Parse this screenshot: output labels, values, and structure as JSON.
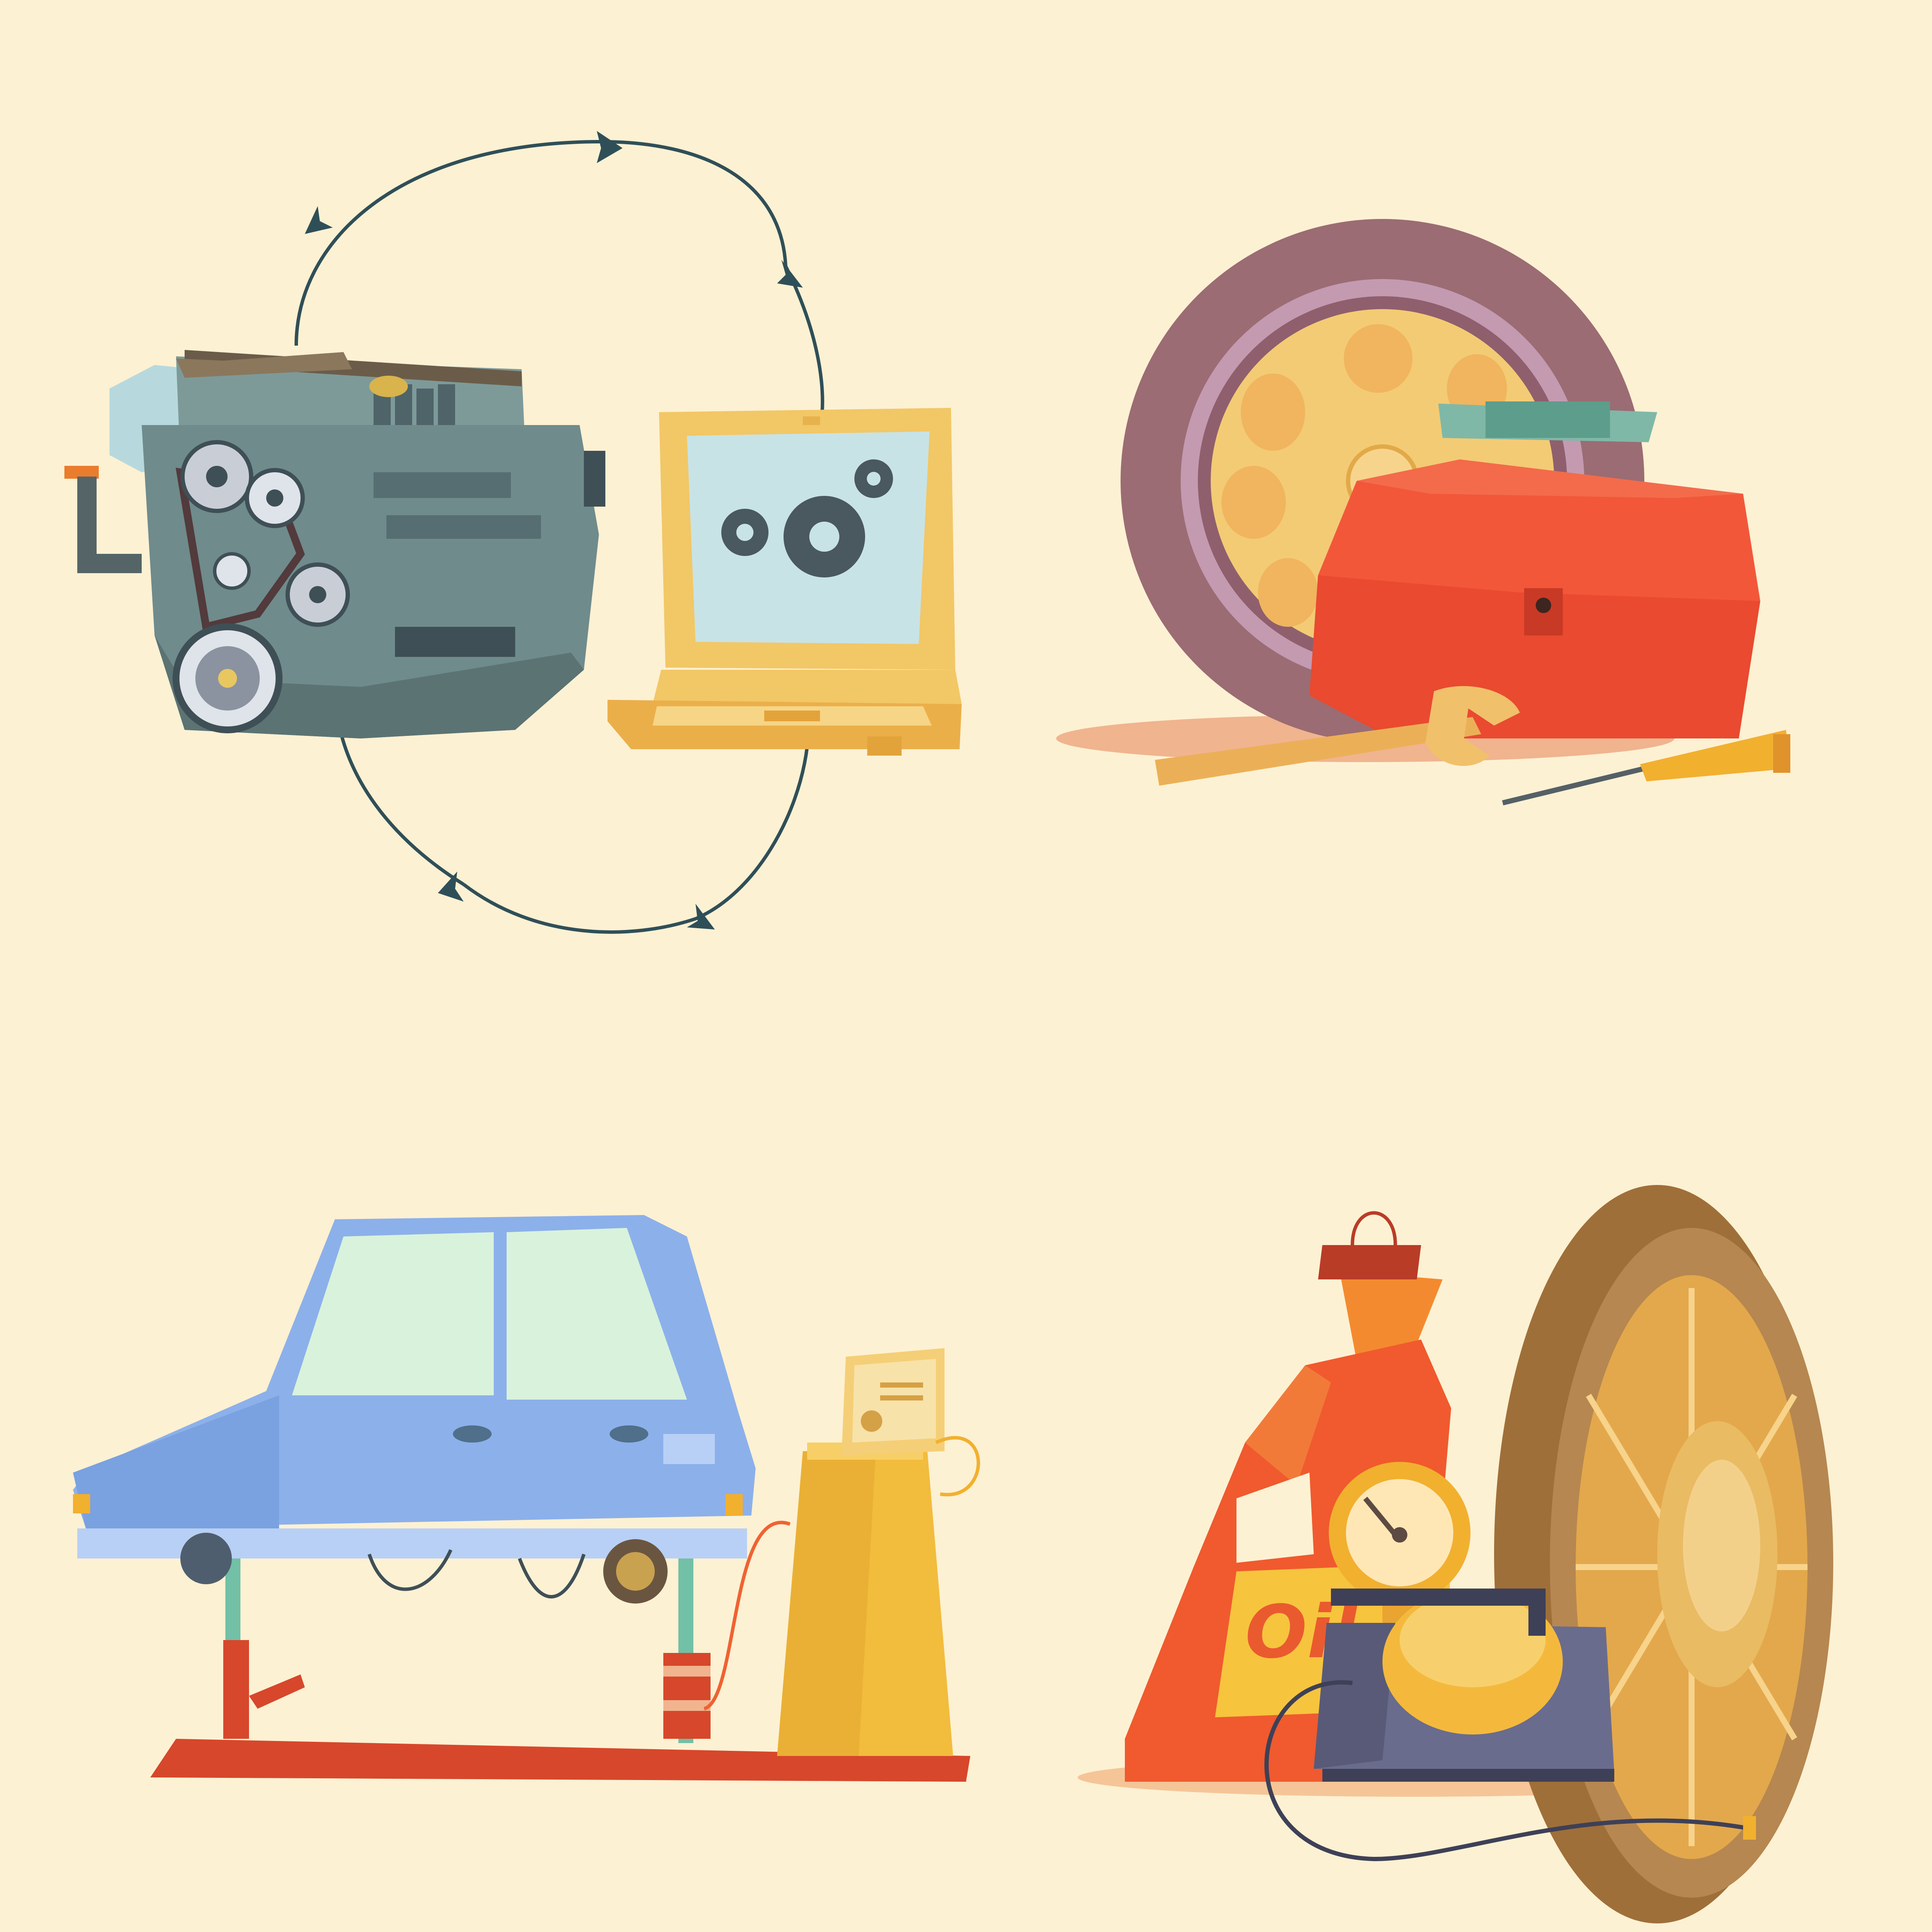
{
  "canvas": {
    "background": "#fdf1d3"
  },
  "scenes": {
    "diagnostics": {
      "icons": [
        "engine-icon",
        "laptop-icon",
        "gear-icon",
        "cycle-arrow-icon"
      ],
      "colors": {
        "engine_body": "#6f8b8c",
        "engine_dark": "#3f4f56",
        "laptop_frame": "#f2c766",
        "laptop_screen": "#c8e3e6",
        "gear": "#4a5860",
        "arrow": "#2f4f58"
      }
    },
    "tire_tools": {
      "icons": [
        "tire-icon",
        "toolbox-icon",
        "wrench-icon",
        "screwdriver-icon"
      ],
      "colors": {
        "tire": "#9b6c73",
        "rim": "#f3cb74",
        "toolbox": "#f2573a",
        "toolbox_handle": "#7fb8a7"
      }
    },
    "car_lift": {
      "icons": [
        "car-icon",
        "lift-icon",
        "diagnostic-station-icon"
      ],
      "colors": {
        "car_body": "#8cb0ea",
        "car_window": "#d9f2dc",
        "lift": "#d7472b",
        "station": "#f2bc3d"
      }
    },
    "oil_compressor": {
      "oil_label": "Oil",
      "icons": [
        "oil-canister-icon",
        "pressure-gauge-icon",
        "air-compressor-icon",
        "wheel-icon"
      ],
      "colors": {
        "canister": "#f05a2e",
        "compressor": "#6a6c8d",
        "gauge": "#ffe7b5",
        "wheel": "#b68750"
      }
    }
  }
}
